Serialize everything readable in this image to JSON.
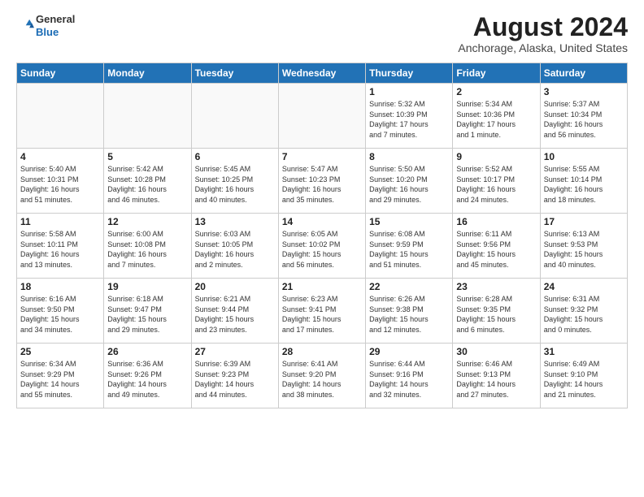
{
  "header": {
    "logo_general": "General",
    "logo_blue": "Blue",
    "month_title": "August 2024",
    "location": "Anchorage, Alaska, United States"
  },
  "weekdays": [
    "Sunday",
    "Monday",
    "Tuesday",
    "Wednesday",
    "Thursday",
    "Friday",
    "Saturday"
  ],
  "weeks": [
    [
      {
        "day": "",
        "info": ""
      },
      {
        "day": "",
        "info": ""
      },
      {
        "day": "",
        "info": ""
      },
      {
        "day": "",
        "info": ""
      },
      {
        "day": "1",
        "info": "Sunrise: 5:32 AM\nSunset: 10:39 PM\nDaylight: 17 hours\nand 7 minutes."
      },
      {
        "day": "2",
        "info": "Sunrise: 5:34 AM\nSunset: 10:36 PM\nDaylight: 17 hours\nand 1 minute."
      },
      {
        "day": "3",
        "info": "Sunrise: 5:37 AM\nSunset: 10:34 PM\nDaylight: 16 hours\nand 56 minutes."
      }
    ],
    [
      {
        "day": "4",
        "info": "Sunrise: 5:40 AM\nSunset: 10:31 PM\nDaylight: 16 hours\nand 51 minutes."
      },
      {
        "day": "5",
        "info": "Sunrise: 5:42 AM\nSunset: 10:28 PM\nDaylight: 16 hours\nand 46 minutes."
      },
      {
        "day": "6",
        "info": "Sunrise: 5:45 AM\nSunset: 10:25 PM\nDaylight: 16 hours\nand 40 minutes."
      },
      {
        "day": "7",
        "info": "Sunrise: 5:47 AM\nSunset: 10:23 PM\nDaylight: 16 hours\nand 35 minutes."
      },
      {
        "day": "8",
        "info": "Sunrise: 5:50 AM\nSunset: 10:20 PM\nDaylight: 16 hours\nand 29 minutes."
      },
      {
        "day": "9",
        "info": "Sunrise: 5:52 AM\nSunset: 10:17 PM\nDaylight: 16 hours\nand 24 minutes."
      },
      {
        "day": "10",
        "info": "Sunrise: 5:55 AM\nSunset: 10:14 PM\nDaylight: 16 hours\nand 18 minutes."
      }
    ],
    [
      {
        "day": "11",
        "info": "Sunrise: 5:58 AM\nSunset: 10:11 PM\nDaylight: 16 hours\nand 13 minutes."
      },
      {
        "day": "12",
        "info": "Sunrise: 6:00 AM\nSunset: 10:08 PM\nDaylight: 16 hours\nand 7 minutes."
      },
      {
        "day": "13",
        "info": "Sunrise: 6:03 AM\nSunset: 10:05 PM\nDaylight: 16 hours\nand 2 minutes."
      },
      {
        "day": "14",
        "info": "Sunrise: 6:05 AM\nSunset: 10:02 PM\nDaylight: 15 hours\nand 56 minutes."
      },
      {
        "day": "15",
        "info": "Sunrise: 6:08 AM\nSunset: 9:59 PM\nDaylight: 15 hours\nand 51 minutes."
      },
      {
        "day": "16",
        "info": "Sunrise: 6:11 AM\nSunset: 9:56 PM\nDaylight: 15 hours\nand 45 minutes."
      },
      {
        "day": "17",
        "info": "Sunrise: 6:13 AM\nSunset: 9:53 PM\nDaylight: 15 hours\nand 40 minutes."
      }
    ],
    [
      {
        "day": "18",
        "info": "Sunrise: 6:16 AM\nSunset: 9:50 PM\nDaylight: 15 hours\nand 34 minutes."
      },
      {
        "day": "19",
        "info": "Sunrise: 6:18 AM\nSunset: 9:47 PM\nDaylight: 15 hours\nand 29 minutes."
      },
      {
        "day": "20",
        "info": "Sunrise: 6:21 AM\nSunset: 9:44 PM\nDaylight: 15 hours\nand 23 minutes."
      },
      {
        "day": "21",
        "info": "Sunrise: 6:23 AM\nSunset: 9:41 PM\nDaylight: 15 hours\nand 17 minutes."
      },
      {
        "day": "22",
        "info": "Sunrise: 6:26 AM\nSunset: 9:38 PM\nDaylight: 15 hours\nand 12 minutes."
      },
      {
        "day": "23",
        "info": "Sunrise: 6:28 AM\nSunset: 9:35 PM\nDaylight: 15 hours\nand 6 minutes."
      },
      {
        "day": "24",
        "info": "Sunrise: 6:31 AM\nSunset: 9:32 PM\nDaylight: 15 hours\nand 0 minutes."
      }
    ],
    [
      {
        "day": "25",
        "info": "Sunrise: 6:34 AM\nSunset: 9:29 PM\nDaylight: 14 hours\nand 55 minutes."
      },
      {
        "day": "26",
        "info": "Sunrise: 6:36 AM\nSunset: 9:26 PM\nDaylight: 14 hours\nand 49 minutes."
      },
      {
        "day": "27",
        "info": "Sunrise: 6:39 AM\nSunset: 9:23 PM\nDaylight: 14 hours\nand 44 minutes."
      },
      {
        "day": "28",
        "info": "Sunrise: 6:41 AM\nSunset: 9:20 PM\nDaylight: 14 hours\nand 38 minutes."
      },
      {
        "day": "29",
        "info": "Sunrise: 6:44 AM\nSunset: 9:16 PM\nDaylight: 14 hours\nand 32 minutes."
      },
      {
        "day": "30",
        "info": "Sunrise: 6:46 AM\nSunset: 9:13 PM\nDaylight: 14 hours\nand 27 minutes."
      },
      {
        "day": "31",
        "info": "Sunrise: 6:49 AM\nSunset: 9:10 PM\nDaylight: 14 hours\nand 21 minutes."
      }
    ]
  ]
}
